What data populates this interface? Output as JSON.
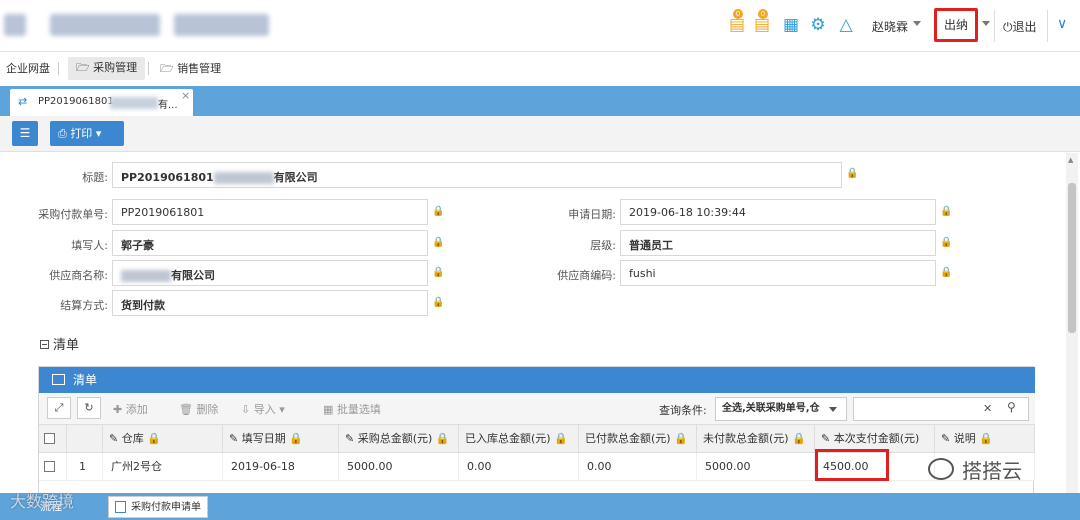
{
  "header": {
    "user_name": "赵晓霖",
    "role_button": "出纳",
    "logout": "退出",
    "icons": [
      "notice-icon",
      "message-icon",
      "calendar-icon",
      "settings-icon",
      "theme-icon"
    ]
  },
  "modules": {
    "items": [
      "企业网盘",
      "采购管理",
      "销售管理"
    ]
  },
  "tab": {
    "label": "PP2019061801",
    "label_suffix": "有...",
    "close": "×"
  },
  "toolbar": {
    "print_label": "打印"
  },
  "form": {
    "title_label": "标题:",
    "title_value_prefix": "PP2019061801",
    "title_value_suffix": "有限公司",
    "purchase_no_label": "采购付款单号:",
    "purchase_no_value": "PP2019061801",
    "apply_date_label": "申请日期:",
    "apply_date_value": "2019-06-18 10:39:44",
    "filler_label": "填写人:",
    "filler_value": "郭子豪",
    "level_label": "层级:",
    "level_value": "普通员工",
    "supplier_name_label": "供应商名称:",
    "supplier_name_suffix": "有限公司",
    "supplier_code_label": "供应商编码:",
    "supplier_code_value": "fushi",
    "settle_label": "结算方式:",
    "settle_value": "货到付款"
  },
  "detail": {
    "section_title": "清单",
    "panel_title": "清单",
    "tools": {
      "add": "添加",
      "delete": "删除",
      "import": "导入",
      "batch": "批量选填"
    },
    "query_label": "查询条件:",
    "query_value": "全选,关联采购单号,仓",
    "columns": [
      "仓库",
      "填写日期",
      "采购总金额(元)",
      "已入库总金额(元)",
      "已付款总金额(元)",
      "未付款总金额(元)",
      "本次支付金额(元)",
      "说明"
    ],
    "rows": [
      {
        "index": "1",
        "warehouse": "广州2号仓",
        "date": "2019-06-18",
        "total": "5000.00",
        "stored": "0.00",
        "paid": "0.00",
        "unpaid": "5000.00",
        "this_payment": "4500.00",
        "note": ""
      }
    ]
  },
  "bottom": {
    "tab1": "流程",
    "tab2": "采购付款申请单"
  },
  "watermarks": {
    "left": "大数跨境",
    "right": "搭搭云"
  },
  "colors": {
    "accent": "#3c87cf",
    "tab_strip": "#5ea3d9",
    "highlight": "#e02020",
    "badge": "#f5a623"
  }
}
